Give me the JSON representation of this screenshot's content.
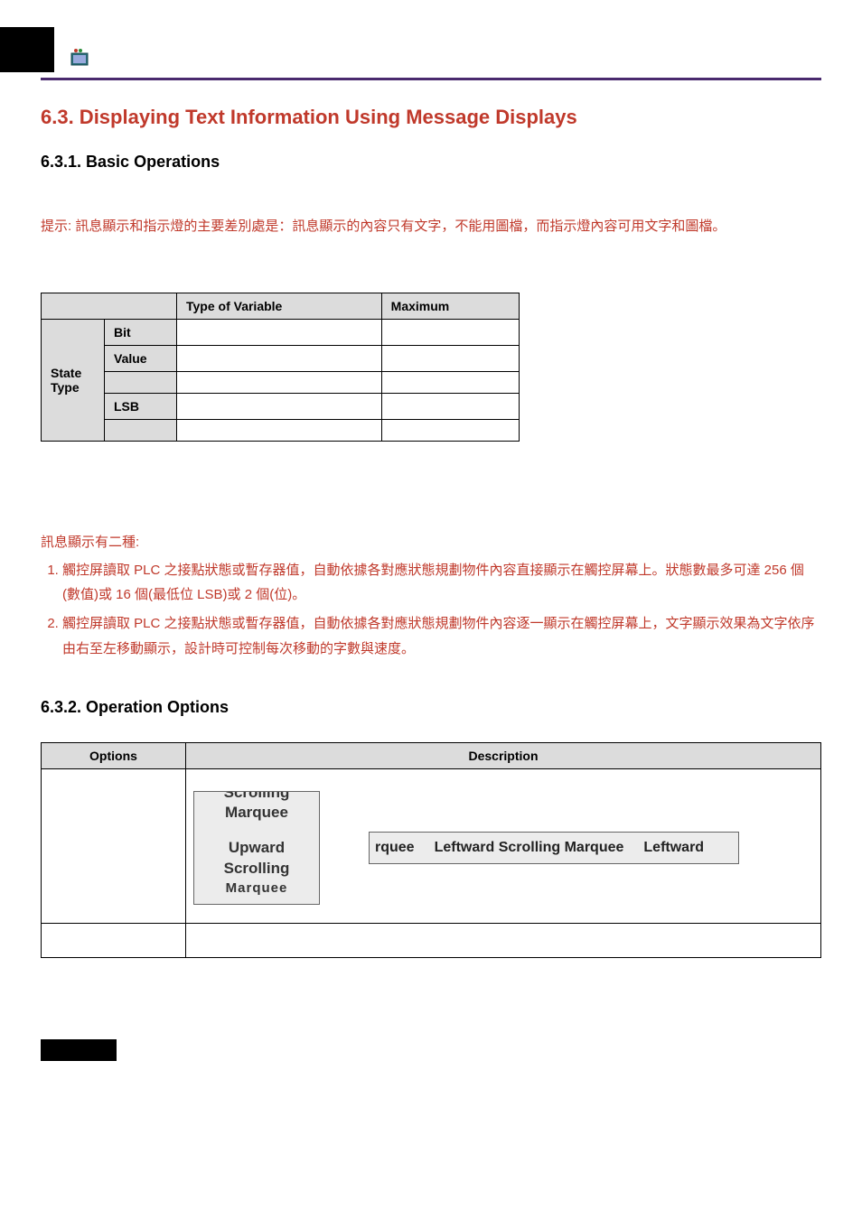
{
  "section": {
    "number_title": "6.3. Displaying Text Information Using Message Displays",
    "sub1": "6.3.1. Basic Operations",
    "sub2": "6.3.2. Operation Options"
  },
  "hint": "提示: 訊息顯示和指示燈的主要差別處是：訊息顯示的內容只有文字，不能用圖檔，而指示燈內容可用文字和圖檔。",
  "var_table": {
    "headers": {
      "type_of_variable": "Type of Variable",
      "maximum": "Maximum"
    },
    "row_label": "State Type",
    "rows": [
      {
        "label": "Bit",
        "type": "",
        "max": ""
      },
      {
        "label": "Value",
        "type": "",
        "max": ""
      },
      {
        "label": "",
        "type": "",
        "max": ""
      },
      {
        "label": "LSB",
        "type": "",
        "max": ""
      },
      {
        "label": "",
        "type": "",
        "max": ""
      }
    ]
  },
  "types_intro": "訊息顯示有二種:",
  "types_list": [
    "觸控屏讀取 PLC 之接點狀態或暫存器值，自動依據各對應狀態規劃物件內容直接顯示在觸控屏幕上。狀態數最多可達 256 個(數值)或 16 個(最低位 LSB)或 2 個(位)。",
    "觸控屏讀取 PLC 之接點狀態或暫存器值，自動依據各對應狀態規劃物件內容逐一顯示在觸控屏幕上，文字顯示效果為文字依序由右至左移動顯示，設計時可控制每次移動的字數與速度。"
  ],
  "ops_table": {
    "headers": {
      "options": "Options",
      "description": "Description"
    },
    "panel": {
      "line1": "Scrolling",
      "line2": "Marquee",
      "line3": "Upward",
      "line4": "Scrolling",
      "line5_cut": "Marquee"
    },
    "marquee": {
      "left_cut": "rquee",
      "mid": "Leftward Scrolling Marquee",
      "right_cut": "Leftward"
    }
  }
}
